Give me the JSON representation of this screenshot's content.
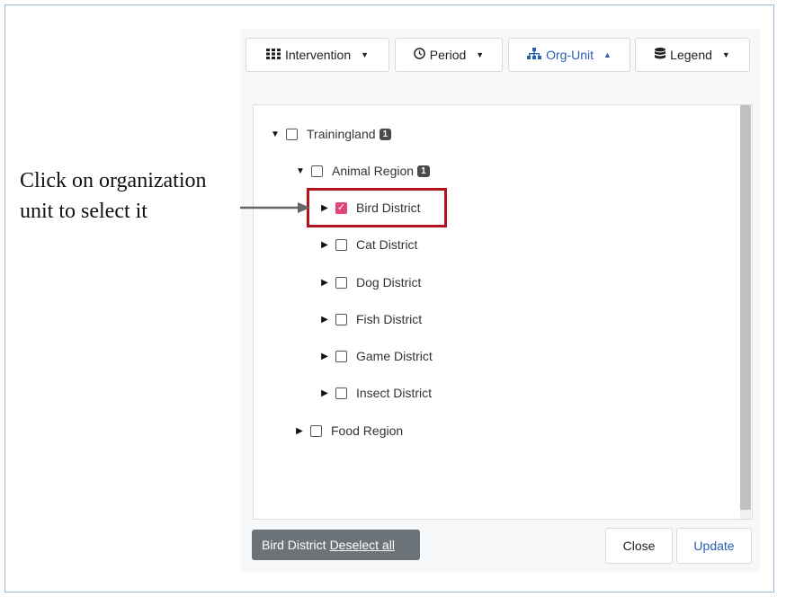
{
  "toolbar": {
    "intervention_label": "Intervention",
    "period_label": "Period",
    "orgunit_label": "Org-Unit",
    "legend_label": "Legend"
  },
  "tree": {
    "root": {
      "label": "Trainingland",
      "badge": "1"
    },
    "region_animal": {
      "label": "Animal Region",
      "badge": "1"
    },
    "districts": [
      {
        "label": "Bird District",
        "checked": true
      },
      {
        "label": "Cat District",
        "checked": false
      },
      {
        "label": "Dog District",
        "checked": false
      },
      {
        "label": "Fish District",
        "checked": false
      },
      {
        "label": "Game District",
        "checked": false
      },
      {
        "label": "Insect District",
        "checked": false
      }
    ],
    "region_food": {
      "label": "Food Region"
    }
  },
  "annotation": {
    "text": "Click on organization unit to select it"
  },
  "footer": {
    "selected_label": "Bird District",
    "deselect_label": "Deselect all",
    "close_label": "Close",
    "update_label": "Update"
  },
  "colors": {
    "accent": "#2a5fb0",
    "checkbox_checked": "#e0457b",
    "highlight_border": "#b3121f"
  }
}
